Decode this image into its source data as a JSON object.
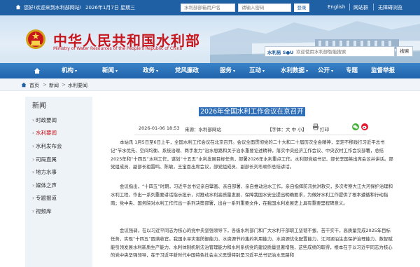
{
  "topbar": {
    "welcome": "您好!欢迎来到水利部网站!",
    "date": "2026年1月7日 星期三",
    "mailbox_placeholder": "水利部部箱用户名",
    "password_placeholder": "请输入密码",
    "login_label": "登录",
    "links": [
      "English",
      "网站群",
      "无障碍浏览"
    ]
  },
  "banner": {
    "title": "中华人民共和国水利部",
    "subtitle": "Ministry of Water Resources of the People's Republic of China",
    "search_logo": "水利易 S●U",
    "search_placeholder": "欢迎使用水利部智能搜索",
    "search_button": "搜索"
  },
  "nav": {
    "items": [
      "机构",
      "新闻",
      "政务",
      "党风廉政",
      "服务",
      "互动",
      "水利数据",
      "公开",
      "专题",
      "监督举报"
    ]
  },
  "breadcrumb": [
    "首页",
    "新闻",
    "水利要闻"
  ],
  "sidebar": {
    "title": "新闻",
    "items": [
      "时政要闻",
      "水利要闻",
      "水利发布会",
      "司局直属",
      "地方水事",
      "媒体之声",
      "专题报道",
      "视频库"
    ],
    "active_index": 1
  },
  "article": {
    "title": "2026年全国水利工作会议在京召开",
    "datetime": "2026-01-06 18:53",
    "source": "来源：水利部网站",
    "font_size_label": "【字体：大 中 小】",
    "print_label": "打印",
    "paragraphs": [
      "本站讯 1月5日至6日上午，全国水利工作会议在北京召开。会议全面贯彻党的二十大和二十届历次全会精神，坚定不移践行习近平总书记“节水优先、空间均衡、系统治理、两手发力”治水思路和关于治水重要论述精神，落实中央经济工作会议、中央农村工作会议部署，总结2025年和“十四五”水利工作，谋划“十五五”水利发展目标任务，部署2026年水利重点工作。水利部党组书记、部长李国英出席会议并讲话。部党组成员、副部长祖雷鸣、陈敏，王宝恩出席会议，部党组成员、副部长刘冬顺作总结讲话。",
      "会议指出，“十四五”时期，习近平总书记亲自擘画、亲自部署、亲自推动治水工作，亲自指挥防汛抗洪救灾，多次考察大江大河保护治理和水利工程，作出一系列重要讲话指示批示，对推动水利高质量发展、保障我国水安全提出明确要求，为做好水利工作提供了根本遵循和行动指南；党中央、国务院对水利工作作出一系列决策部署，出台一系列重要文件，在我国水利发展史上具有重要里程碑意义。",
      "会议强调，在以习近平同志为核心的党中央坚强领导下，各级水利部门和广大水利干部职工坚韧不拔、苦干实干，高质量完成2025年目标任务，实现“十四五”圆满收官。我国水旱灾害防御能力、水资源节约集约利用能力、水资源优化配置能力、江河湖泊生态保护治理能力、数智赋能引领发展水利新质生产能力、水利体制机制法治管理能力和水利系统党的建设质量显著增强，这些成绩的取得，根本在于以习近平同志为核心的党中央坚强领导，在于习近平新时代中国特色社会主义思想特别是习近平总书记治水思路和"
    ]
  },
  "colors": {
    "topbar": "#1f5fa3",
    "nav": "#2a71b9",
    "brand_red": "#c8161d",
    "title_highlight": "#2f6fb8"
  },
  "icons": [
    "home-icon",
    "emblem-icon",
    "print-icon",
    "wechat-icon",
    "weibo-icon"
  ]
}
